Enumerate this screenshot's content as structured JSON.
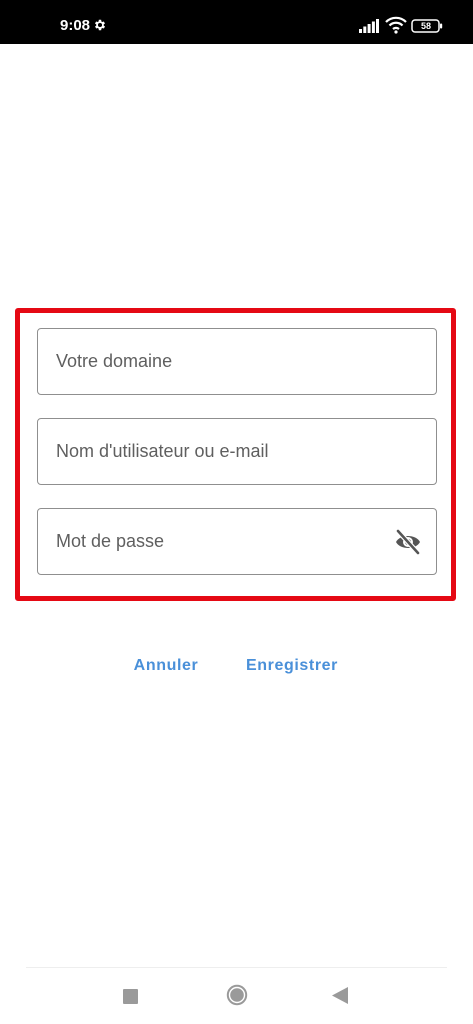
{
  "status_bar": {
    "time": "9:08",
    "battery_level": "58",
    "icons": [
      "gear-icon",
      "signal-icon",
      "wifi-icon",
      "battery-icon"
    ]
  },
  "form": {
    "domain": {
      "placeholder": "Votre domaine",
      "value": ""
    },
    "username": {
      "placeholder": "Nom d'utilisateur ou e-mail",
      "value": ""
    },
    "password": {
      "placeholder": "Mot de passe",
      "value": "",
      "toggle_icon": "eye-off-icon"
    }
  },
  "actions": {
    "cancel_label": "Annuler",
    "save_label": "Enregistrer"
  },
  "navigation_bar": {
    "icons": [
      "recents-icon",
      "home-icon",
      "back-icon"
    ]
  },
  "colors": {
    "status_bar_bg": "#000000",
    "highlight_border": "#e50914",
    "field_border": "#8f8f8f",
    "placeholder_text": "#5f5f5f",
    "action_text": "#4a90d9",
    "nav_icon": "#9a9a9a"
  }
}
